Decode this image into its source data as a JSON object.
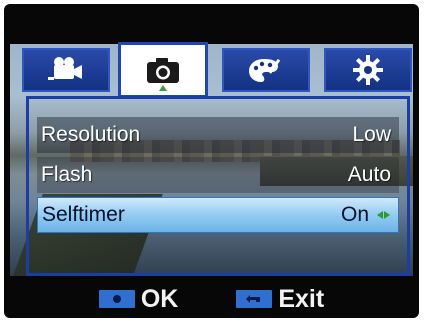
{
  "tabs": [
    {
      "icon": "video-camera-icon",
      "active": false
    },
    {
      "icon": "camera-icon",
      "active": true
    },
    {
      "icon": "palette-icon",
      "active": false
    },
    {
      "icon": "settings-gear-icon",
      "active": false
    }
  ],
  "menu": {
    "items": [
      {
        "label": "Resolution",
        "value": "Low",
        "selected": false
      },
      {
        "label": "Flash",
        "value": "Auto",
        "selected": false
      },
      {
        "label": "Selftimer",
        "value": "On",
        "selected": true
      }
    ]
  },
  "footer": {
    "ok_label": "OK",
    "exit_label": "Exit"
  },
  "colors": {
    "tab_blue": "#123284",
    "frame_blue": "#1b3ea6",
    "highlight": "#92cbf2",
    "key_blue": "#2f6fd0",
    "arrow_green": "#2e9b2e"
  }
}
